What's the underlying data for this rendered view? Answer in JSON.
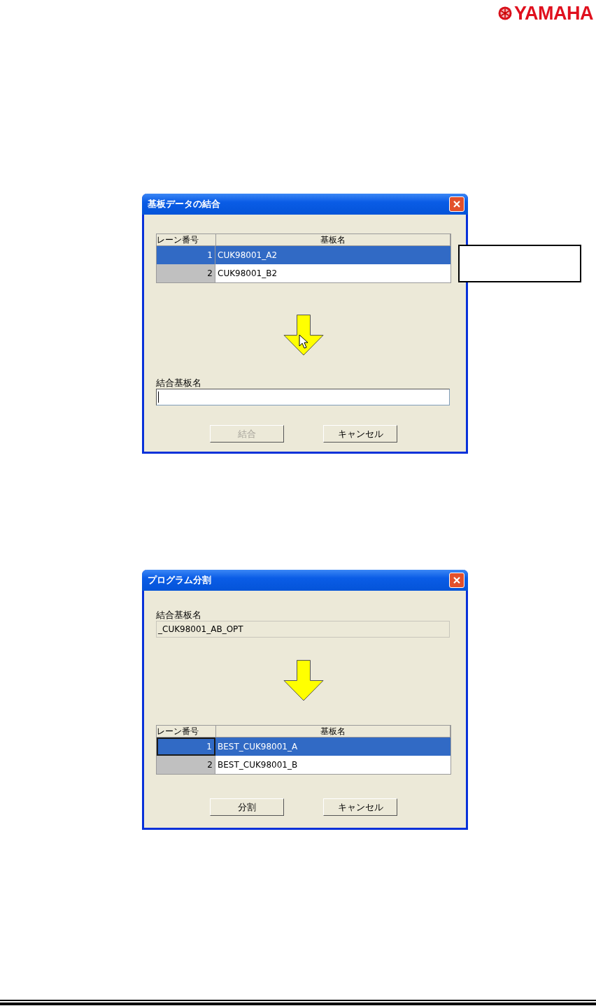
{
  "logo": {
    "text": "YAMAHA"
  },
  "dialogs": [
    {
      "title": "基板データの結合",
      "body": [
        {
          "kind": "table",
          "columns": [
            "レーン番号",
            "基板名"
          ],
          "rows": [
            {
              "lane": "1",
              "name": "CUK98001_A2",
              "selected": true,
              "focused": false
            },
            {
              "lane": "2",
              "name": "CUK98001_B2",
              "selected": false,
              "focused": false
            }
          ]
        },
        {
          "kind": "arrow",
          "pointer": true
        },
        {
          "kind": "field",
          "label": "結合基板名",
          "readonly": false,
          "caret": true
        }
      ],
      "buttons": [
        {
          "label": "結合",
          "disabled": true
        },
        {
          "label": "キャンセル",
          "disabled": false
        }
      ]
    },
    {
      "title": "プログラム分割",
      "body": [
        {
          "kind": "field",
          "label": "結合基板名",
          "value": "_CUK98001_AB_OPT",
          "readonly": true,
          "caret": false
        },
        {
          "kind": "arrow",
          "pointer": false
        },
        {
          "kind": "table",
          "columns": [
            "レーン番号",
            "基板名"
          ],
          "rows": [
            {
              "lane": "1",
              "name": "BEST_CUK98001_A",
              "selected": true,
              "focused": true
            },
            {
              "lane": "2",
              "name": "BEST_CUK98001_B",
              "selected": false,
              "focused": false
            }
          ]
        }
      ],
      "buttons": [
        {
          "label": "分割",
          "disabled": false
        },
        {
          "label": "キャンセル",
          "disabled": false
        }
      ]
    }
  ],
  "callout_box": {
    "shown": true
  }
}
